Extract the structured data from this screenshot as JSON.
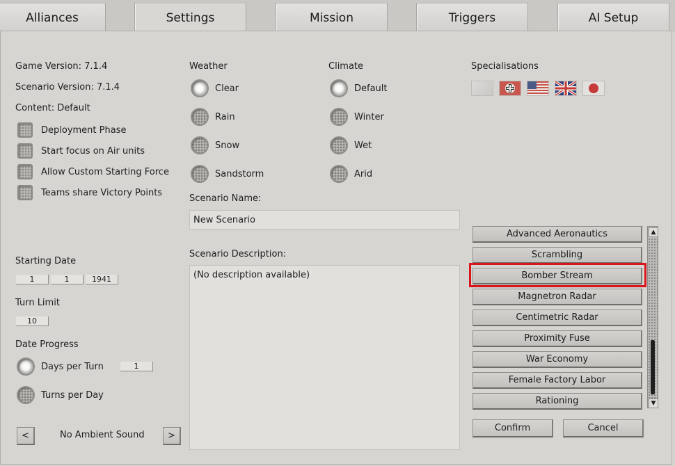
{
  "tabs": [
    "Alliances",
    "Settings",
    "Mission",
    "Triggers",
    "AI Setup"
  ],
  "left": {
    "game_version": "Game Version: 7.1.4",
    "scenario_version": "Scenario Version: 7.1.4",
    "content": "Content: Default",
    "checkboxes": [
      "Deployment Phase",
      "Start focus on Air units",
      "Allow Custom Starting Force",
      "Teams share Victory Points"
    ],
    "starting_date_label": "Starting Date",
    "date": {
      "day": "1",
      "month": "1",
      "year": "1941"
    },
    "turn_limit_label": "Turn Limit",
    "turn_limit": "10",
    "date_progress_label": "Date Progress",
    "days_per_turn_label": "Days per Turn",
    "days_per_turn_value": "1",
    "turns_per_day_label": "Turns per Day",
    "ambient_sound": "No Ambient Sound",
    "prev": "<",
    "next": ">"
  },
  "weather": {
    "label": "Weather",
    "options": [
      "Clear",
      "Rain",
      "Snow",
      "Sandstorm"
    ],
    "selected": "Clear"
  },
  "climate": {
    "label": "Climate",
    "options": [
      "Default",
      "Winter",
      "Wet",
      "Arid"
    ],
    "selected": "Default"
  },
  "scenario_name_label": "Scenario Name:",
  "scenario_name": "New Scenario",
  "scenario_description_label": "Scenario Description:",
  "scenario_description": "(No description available)",
  "specialisations": {
    "label": "Specialisations",
    "flags": [
      "generic-flag-icon",
      "germany-flag-icon",
      "usa-flag-icon",
      "uk-flag-icon",
      "japan-flag-icon"
    ],
    "items": [
      "Advanced Aeronautics",
      "Scrambling",
      "Bomber Stream",
      "Magnetron Radar",
      "Centimetric Radar",
      "Proximity Fuse",
      "War Economy",
      "Female Factory Labor",
      "Rationing"
    ],
    "highlighted": "Bomber Stream"
  },
  "buttons": {
    "confirm": "Confirm",
    "cancel": "Cancel"
  },
  "colors": {
    "highlight": "#d9141a",
    "panel": "#d6d5d2"
  }
}
